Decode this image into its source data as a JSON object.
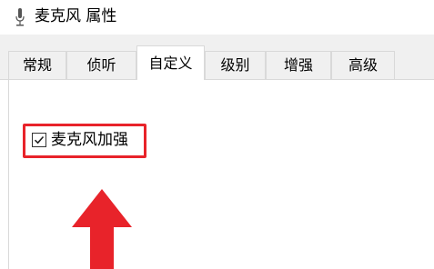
{
  "window": {
    "icon": "microphone-icon",
    "title": "麦克风 属性"
  },
  "tabs": [
    {
      "label": "常规",
      "active": false
    },
    {
      "label": "侦听",
      "active": false
    },
    {
      "label": "自定义",
      "active": true
    },
    {
      "label": "级别",
      "active": false
    },
    {
      "label": "增强",
      "active": false
    },
    {
      "label": "高级",
      "active": false
    }
  ],
  "custom_panel": {
    "mic_boost": {
      "label": "麦克风加强",
      "checked": true
    }
  },
  "annotation": {
    "highlight_color": "#e8232a",
    "arrow_color": "#e8232a",
    "arrow_direction": "up"
  }
}
